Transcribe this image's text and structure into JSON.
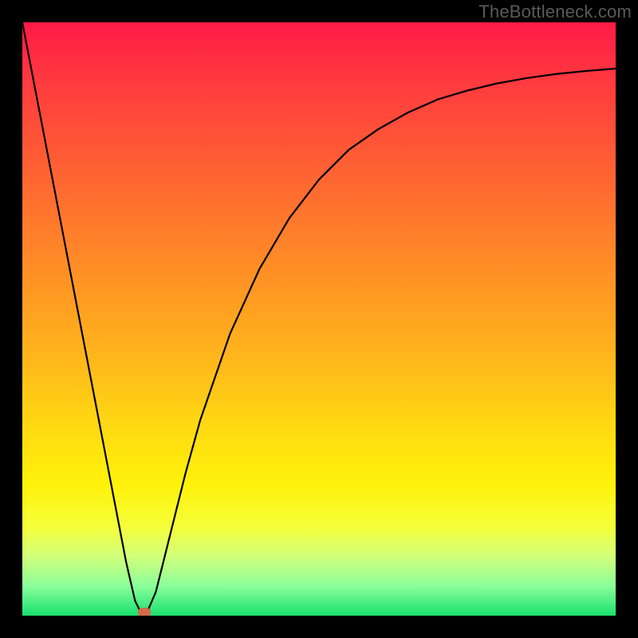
{
  "watermark": "TheBottleneck.com",
  "chart_data": {
    "type": "line",
    "title": "",
    "xlabel": "",
    "ylabel": "",
    "xlim": [
      0,
      100
    ],
    "ylim": [
      0,
      100
    ],
    "grid": false,
    "legend": false,
    "background_gradient_stops": [
      {
        "pct": 0,
        "color": "#ff1a46"
      },
      {
        "pct": 10,
        "color": "#ff3a3f"
      },
      {
        "pct": 22,
        "color": "#ff5a35"
      },
      {
        "pct": 34,
        "color": "#ff7a2c"
      },
      {
        "pct": 46,
        "color": "#ff9a22"
      },
      {
        "pct": 58,
        "color": "#ffba1a"
      },
      {
        "pct": 68,
        "color": "#ffd912"
      },
      {
        "pct": 78,
        "color": "#fff20a"
      },
      {
        "pct": 85,
        "color": "#f5ff3a"
      },
      {
        "pct": 90,
        "color": "#d2ff7a"
      },
      {
        "pct": 95,
        "color": "#8aff9a"
      },
      {
        "pct": 100,
        "color": "#18e06e"
      }
    ],
    "series": [
      {
        "name": "bottleneck-curve",
        "x": [
          0.0,
          2.5,
          5.0,
          7.5,
          10.0,
          12.5,
          15.0,
          17.5,
          19.0,
          20.0,
          21.0,
          22.5,
          25.0,
          27.5,
          30.0,
          35.0,
          40.0,
          45.0,
          50.0,
          55.0,
          60.0,
          65.0,
          70.0,
          75.0,
          80.0,
          85.0,
          90.0,
          95.0,
          100.0
        ],
        "y": [
          100.0,
          87.0,
          74.0,
          61.0,
          48.0,
          35.0,
          22.0,
          9.0,
          2.5,
          0.5,
          0.5,
          4.0,
          14.0,
          24.0,
          33.0,
          47.5,
          58.5,
          67.0,
          73.5,
          78.5,
          82.0,
          84.8,
          87.0,
          88.5,
          89.7,
          90.6,
          91.3,
          91.8,
          92.2
        ]
      }
    ],
    "marker": {
      "x": 20.5,
      "y": 0.5,
      "color": "#d46a4a"
    }
  }
}
